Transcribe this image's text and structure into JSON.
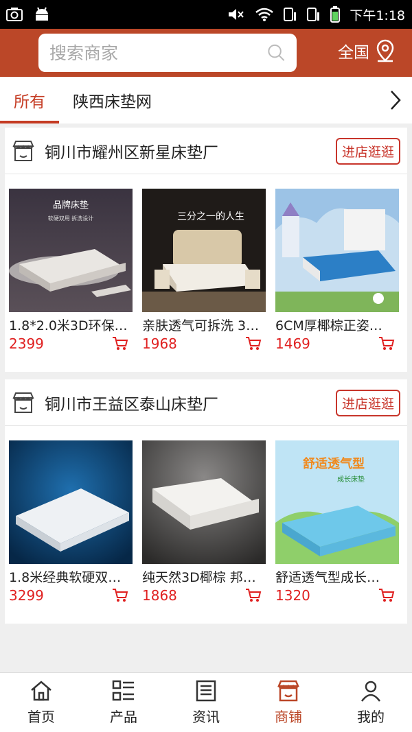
{
  "status": {
    "time": "下午1:18"
  },
  "search": {
    "placeholder": "搜索商家"
  },
  "region": {
    "label": "全国"
  },
  "tabs": [
    {
      "label": "所有",
      "active": true
    },
    {
      "label": "陕西床垫网",
      "active": false
    }
  ],
  "shops": [
    {
      "name": "铜川市耀州区新星床垫厂",
      "enter_label": "进店逛逛",
      "products": [
        {
          "title": "1.8*2.0米3D环保…",
          "price": "2399",
          "image": "mattress-brand-photo"
        },
        {
          "title": "亲肤透气可拆洗 3…",
          "price": "1968",
          "image": "bed-with-mattress-photo"
        },
        {
          "title": "6CM厚椰棕正姿…",
          "price": "1469",
          "image": "kids-bed-blue-mattress-photo"
        }
      ]
    },
    {
      "name": "铜川市王益区泰山床垫厂",
      "enter_label": "进店逛逛",
      "products": [
        {
          "title": "1.8米经典软硬双…",
          "price": "3299",
          "image": "white-mattress-blue-bg-photo"
        },
        {
          "title": "纯天然3D椰棕 邦…",
          "price": "1868",
          "image": "white-mattress-grey-bg-photo"
        },
        {
          "title": "舒适透气型成长…",
          "price": "1320",
          "image": "blue-kids-mattress-photo"
        }
      ]
    }
  ],
  "product_image_text": {
    "p1": "品牌床垫",
    "p1_sub": "软硬双用  拆洗设计",
    "p2": "三分之一的人生",
    "p6": "舒适透气型",
    "p6_sub": "成长床垫"
  },
  "nav": [
    {
      "label": "首页",
      "icon": "home-icon",
      "active": false
    },
    {
      "label": "产品",
      "icon": "list-icon",
      "active": false
    },
    {
      "label": "资讯",
      "icon": "news-icon",
      "active": false
    },
    {
      "label": "商铺",
      "icon": "shop-icon",
      "active": true
    },
    {
      "label": "我的",
      "icon": "user-icon",
      "active": false
    }
  ],
  "colors": {
    "brand": "#bb4728",
    "price": "#e02020",
    "accent": "#c8352b"
  }
}
